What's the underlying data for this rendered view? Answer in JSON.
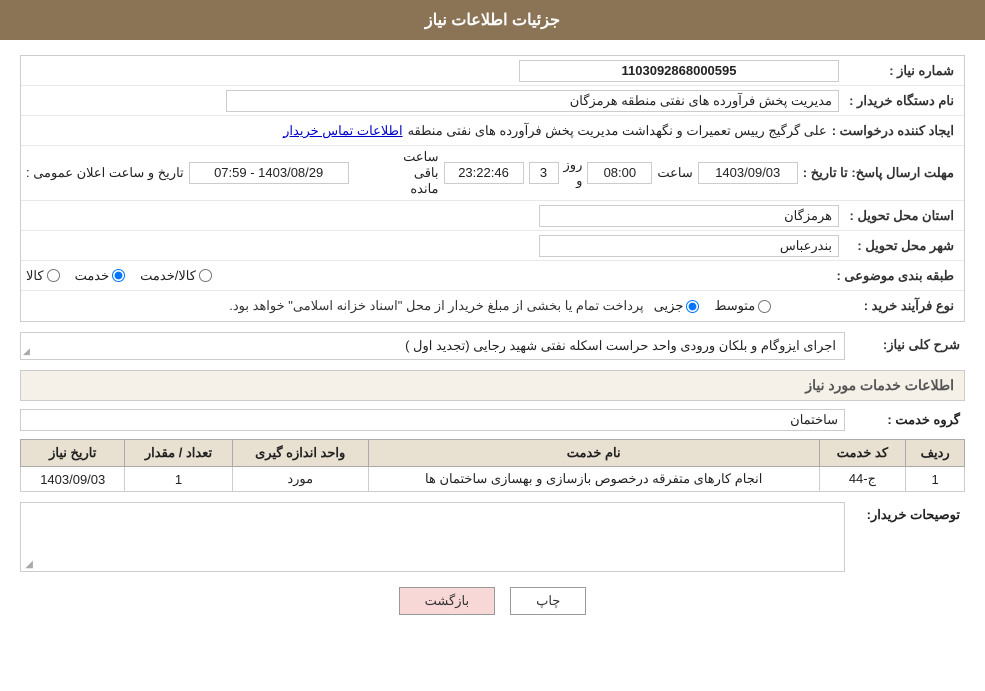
{
  "page": {
    "title": "جزئیات اطلاعات نیاز"
  },
  "header": {
    "label": "جزئیات اطلاعات نیاز"
  },
  "fields": {
    "shomareNiaz_label": "شماره نیاز :",
    "shomareNiaz_value": "1103092868000595",
    "namDastgah_label": "نام دستگاه خریدار :",
    "namDastgah_value": "مدیریت پخش فرآورده های نفتی منطقه هرمزگان",
    "ijadKonande_label": "ایجاد کننده درخواست :",
    "ijadKonande_value": "علی گرگیج رییس تعمیرات و نگهداشت مدیریت پخش فرآورده های نفتی منطقه",
    "ijadKonande_link": "اطلاعات تماس خریدار",
    "mohlat_label": "مهلت ارسال پاسخ: تا تاریخ :",
    "taarikh_value": "1403/09/03",
    "saat_label": "ساعت",
    "saat_value": "08:00",
    "rooz_label": "روز و",
    "rooz_value": "3",
    "baghimande_label": "ساعت باقی مانده",
    "baghimande_value": "23:22:46",
    "tarikh_ilan_label": "تاریخ و ساعت اعلان عمومی :",
    "tarikh_ilan_value": "1403/08/29 - 07:59",
    "ostan_label": "استان محل تحویل :",
    "ostan_value": "هرمزگان",
    "shahr_label": "شهر محل تحویل :",
    "shahr_value": "بندرعباس",
    "tabaghe_label": "طبقه بندی موضوعی :",
    "tabaghe_radios": [
      "کالا",
      "خدمت",
      "کالا/خدمت"
    ],
    "tabaghe_selected": "خدمت",
    "navFarayand_label": "نوع فرآیند خرید :",
    "navFarayand_radios": [
      "جزیی",
      "متوسط"
    ],
    "navFarayand_note": "پرداخت تمام یا بخشی از مبلغ خریدار از محل \"اسناد خزانه اسلامی\" خواهد بود.",
    "sharhKoli_label": "شرح کلی نیاز:",
    "sharhKoli_value": "اجرای ایزوگام و  بلکان ورودی واحد حراست اسکله نفتی شهید رجایی (تجدید اول )",
    "khadamat_title": "اطلاعات خدمات مورد نیاز",
    "groheKhedmat_label": "گروه خدمت :",
    "groheKhedmat_value": "ساختمان",
    "table": {
      "headers": [
        "ردیف",
        "کد خدمت",
        "نام خدمت",
        "واحد اندازه گیری",
        "تعداد / مقدار",
        "تاریخ نیاز"
      ],
      "rows": [
        {
          "radif": "1",
          "kod": "ج-44",
          "nam": "انجام کارهای متفرقه درخصوص بازسازی و بهسازی ساختمان ها",
          "vahed": "مورد",
          "tedad": "1",
          "tarikh": "1403/09/03"
        }
      ]
    },
    "tosihKharidar_label": "توصیحات خریدار:",
    "tosihKharidar_value": ""
  },
  "buttons": {
    "print_label": "چاپ",
    "back_label": "بازگشت"
  }
}
